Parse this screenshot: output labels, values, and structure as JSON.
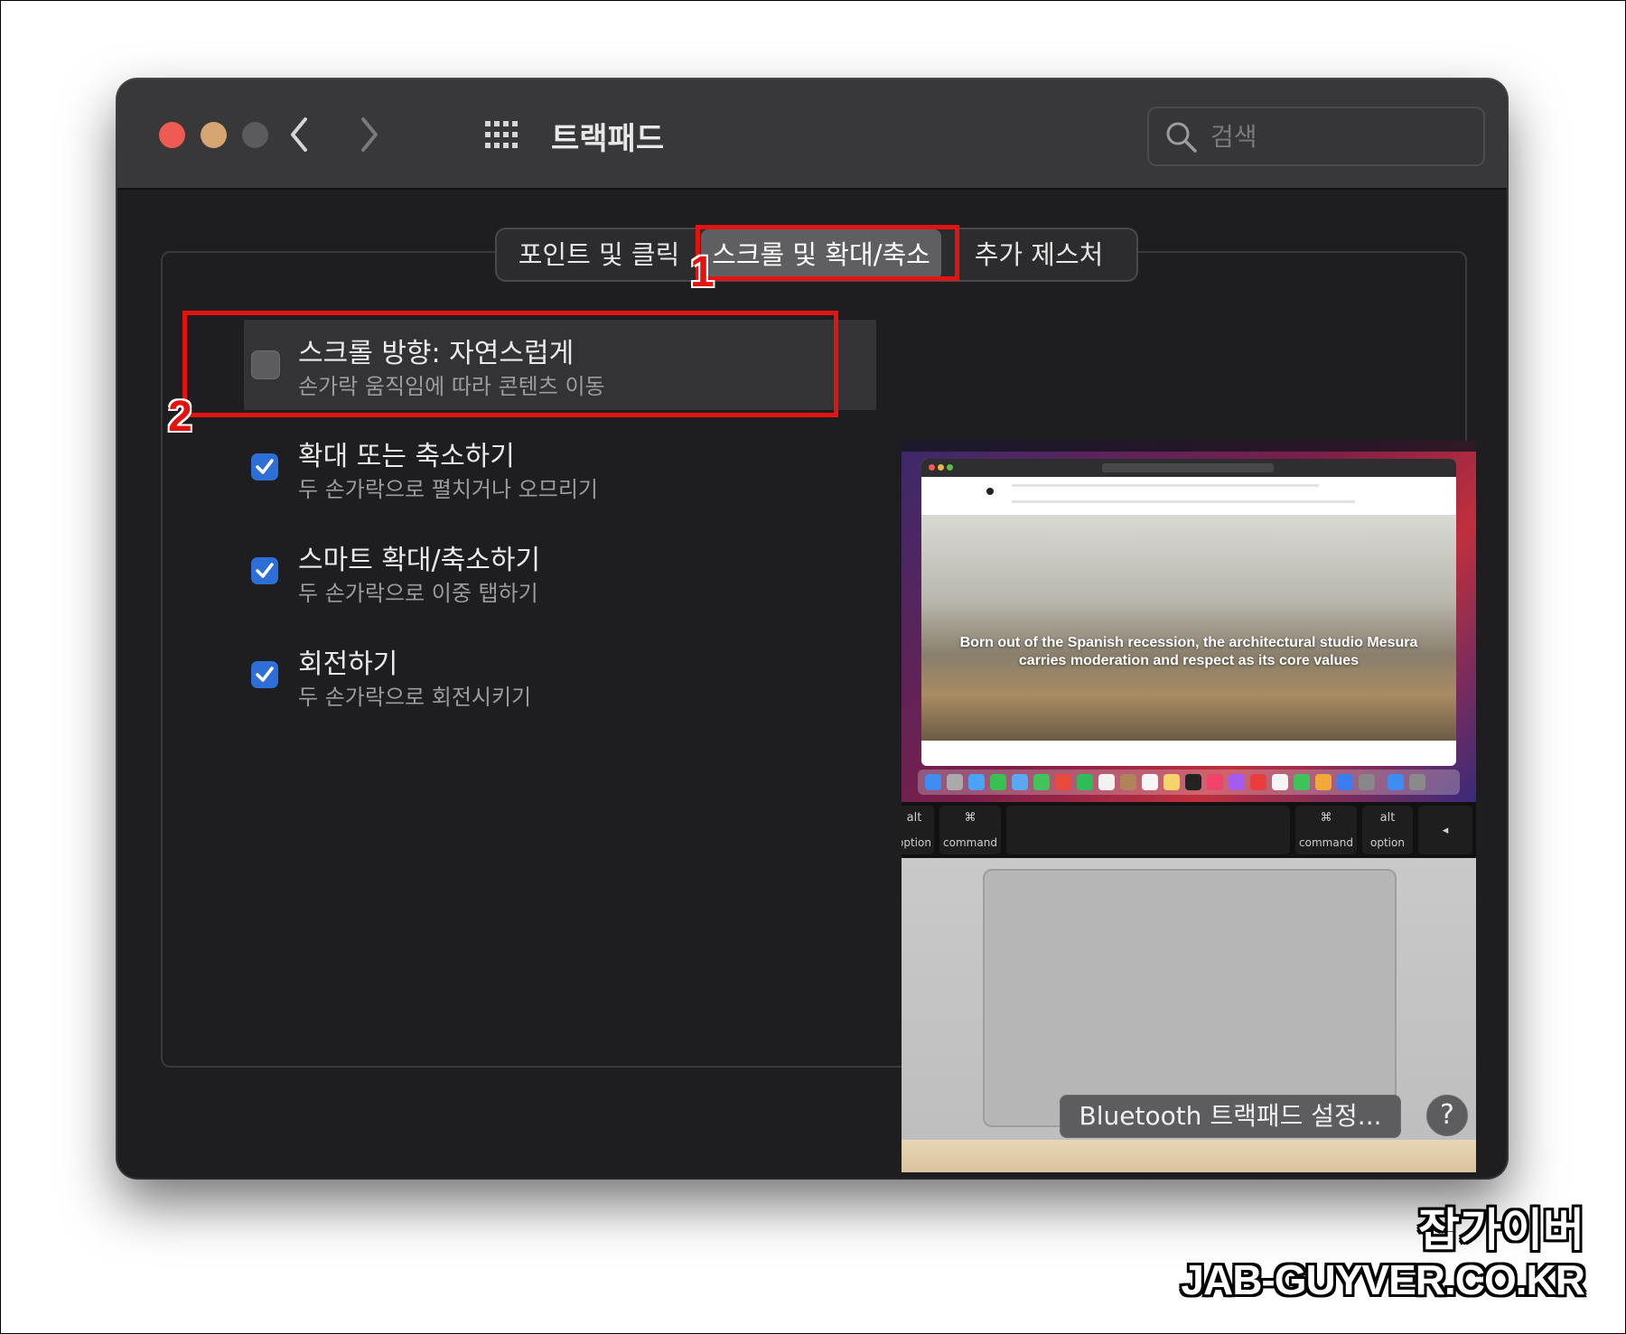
{
  "window": {
    "title": "트랙패드",
    "search_placeholder": "검색"
  },
  "tabs": [
    {
      "label": "포인트 및 클릭",
      "selected": false
    },
    {
      "label": "스크롤 및 확대/축소",
      "selected": true
    },
    {
      "label": "추가 제스처",
      "selected": false
    }
  ],
  "annotations": {
    "marker_1": "1",
    "marker_2": "2",
    "color": "#e4130f"
  },
  "options": [
    {
      "title": "스크롤 방향: 자연스럽게",
      "subtitle": "손가락 움직임에 따라 콘텐츠 이동",
      "checked": false
    },
    {
      "title": "확대 또는 축소하기",
      "subtitle": "두 손가락으로 펼치거나 오므리기",
      "checked": true
    },
    {
      "title": "스마트 확대/축소하기",
      "subtitle": "두 손가락으로 이중 탭하기",
      "checked": true
    },
    {
      "title": "회전하기",
      "subtitle": "두 손가락으로 회전시키기",
      "checked": true
    }
  ],
  "preview": {
    "headline": "Born out of the Spanish recession, the architectural studio Mesura carries moderation and respect as its core values",
    "keys": {
      "left_alt": "alt",
      "left_option": "option",
      "left_cmd_symbol": "⌘",
      "left_command": "command",
      "right_cmd_symbol": "⌘",
      "right_command": "command",
      "right_alt": "alt",
      "right_option": "option"
    }
  },
  "footer": {
    "bluetooth_button": "Bluetooth 트랙패드 설정...",
    "help_button": "?"
  },
  "watermark": {
    "line1": "잡가이버",
    "line2": "JAB-GUYVER.CO.KR"
  },
  "colors": {
    "accent": "#2d6fd6",
    "close": "#ed5b52",
    "minimize": "#d6a571"
  }
}
